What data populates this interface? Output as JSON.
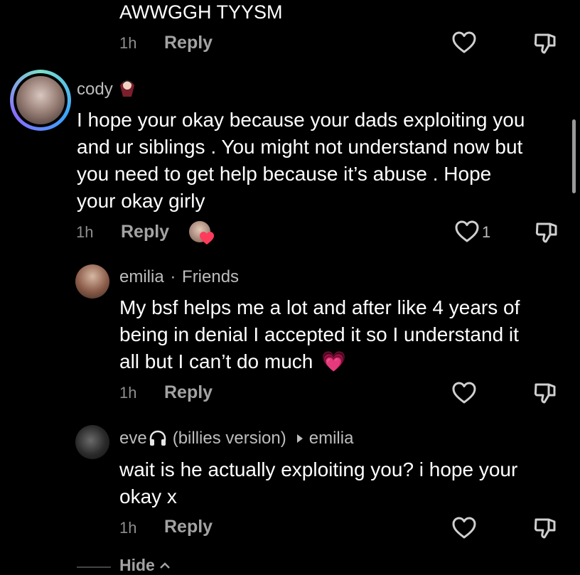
{
  "top_comment": {
    "text": "AWWGGH TYYSM",
    "time": "1h",
    "reply_label": "Reply"
  },
  "comment_cody": {
    "username": "cody",
    "text_lines": [
      "I hope your okay because your dads exploiting you",
      "and ur siblings . You might not understand now but",
      "you need to get help because it’s abuse . Hope",
      "your okay girly"
    ],
    "time": "1h",
    "reply_label": "Reply",
    "like_count": "1"
  },
  "reply_emilia": {
    "username": "emilia",
    "separator": "·",
    "tag": "Friends",
    "text_lines": [
      "My bsf helps me a lot and after like 4 years of",
      "being in denial I accepted it so I understand it",
      "all but I can’t do much"
    ],
    "emoji": "💗",
    "time": "1h",
    "reply_label": "Reply"
  },
  "reply_eve": {
    "username": "eve",
    "username_suffix": "(billies version)",
    "reply_to": "emilia",
    "text_lines": [
      "wait is he actually exploiting you? i hope your",
      "okay x"
    ],
    "time": "1h",
    "reply_label": "Reply"
  },
  "footer": {
    "hide_label": "Hide"
  },
  "icons": {
    "like": "heart-outline-icon",
    "dislike": "thumbs-down-icon",
    "creator_like": "creator-heart-avatar-icon",
    "badge": "vampire-emoji-icon",
    "headphones": "headphones-icon",
    "reply_arrow": "caret-right-icon"
  },
  "colors": {
    "background": "#000000",
    "text": "#ffffff",
    "muted": "#a3a3a3",
    "creator_heart": "#ff3b5c"
  }
}
